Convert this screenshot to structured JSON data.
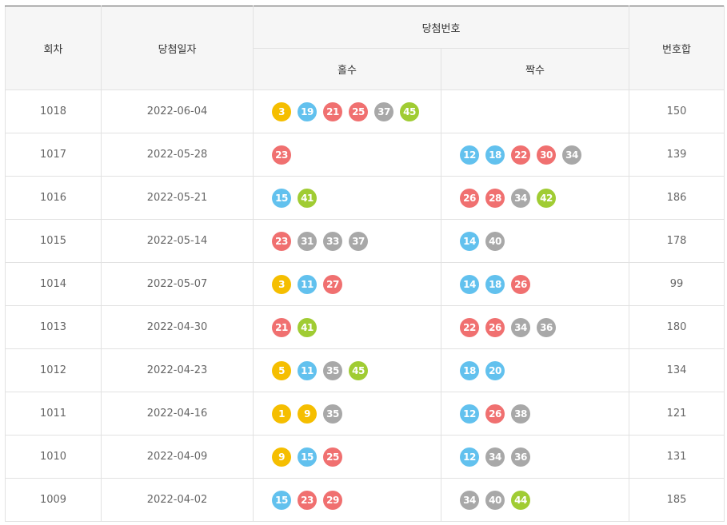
{
  "header": {
    "round": "회차",
    "date": "당첨일자",
    "winning_numbers": "당첨번호",
    "odd": "홀수",
    "even": "짝수",
    "sum": "번호합"
  },
  "ball_colors": {
    "1-10": "#f5be00",
    "11-20": "#62c1ee",
    "21-30": "#f07070",
    "31-40": "#a8a8a8",
    "41-45": "#a0cc33"
  },
  "rows": [
    {
      "round": "1018",
      "date": "2022-06-04",
      "odd": [
        "3",
        "19",
        "21",
        "25",
        "37",
        "45"
      ],
      "even": [],
      "sum": "150"
    },
    {
      "round": "1017",
      "date": "2022-05-28",
      "odd": [
        "23"
      ],
      "even": [
        "12",
        "18",
        "22",
        "30",
        "34"
      ],
      "sum": "139"
    },
    {
      "round": "1016",
      "date": "2022-05-21",
      "odd": [
        "15",
        "41"
      ],
      "even": [
        "26",
        "28",
        "34",
        "42"
      ],
      "sum": "186"
    },
    {
      "round": "1015",
      "date": "2022-05-14",
      "odd": [
        "23",
        "31",
        "33",
        "37"
      ],
      "even": [
        "14",
        "40"
      ],
      "sum": "178"
    },
    {
      "round": "1014",
      "date": "2022-05-07",
      "odd": [
        "3",
        "11",
        "27"
      ],
      "even": [
        "14",
        "18",
        "26"
      ],
      "sum": "99"
    },
    {
      "round": "1013",
      "date": "2022-04-30",
      "odd": [
        "21",
        "41"
      ],
      "even": [
        "22",
        "26",
        "34",
        "36"
      ],
      "sum": "180"
    },
    {
      "round": "1012",
      "date": "2022-04-23",
      "odd": [
        "5",
        "11",
        "35",
        "45"
      ],
      "even": [
        "18",
        "20"
      ],
      "sum": "134"
    },
    {
      "round": "1011",
      "date": "2022-04-16",
      "odd": [
        "1",
        "9",
        "35"
      ],
      "even": [
        "12",
        "26",
        "38"
      ],
      "sum": "121"
    },
    {
      "round": "1010",
      "date": "2022-04-09",
      "odd": [
        "9",
        "15",
        "25"
      ],
      "even": [
        "12",
        "34",
        "36"
      ],
      "sum": "131"
    },
    {
      "round": "1009",
      "date": "2022-04-02",
      "odd": [
        "15",
        "23",
        "29"
      ],
      "even": [
        "34",
        "40",
        "44"
      ],
      "sum": "185"
    }
  ]
}
